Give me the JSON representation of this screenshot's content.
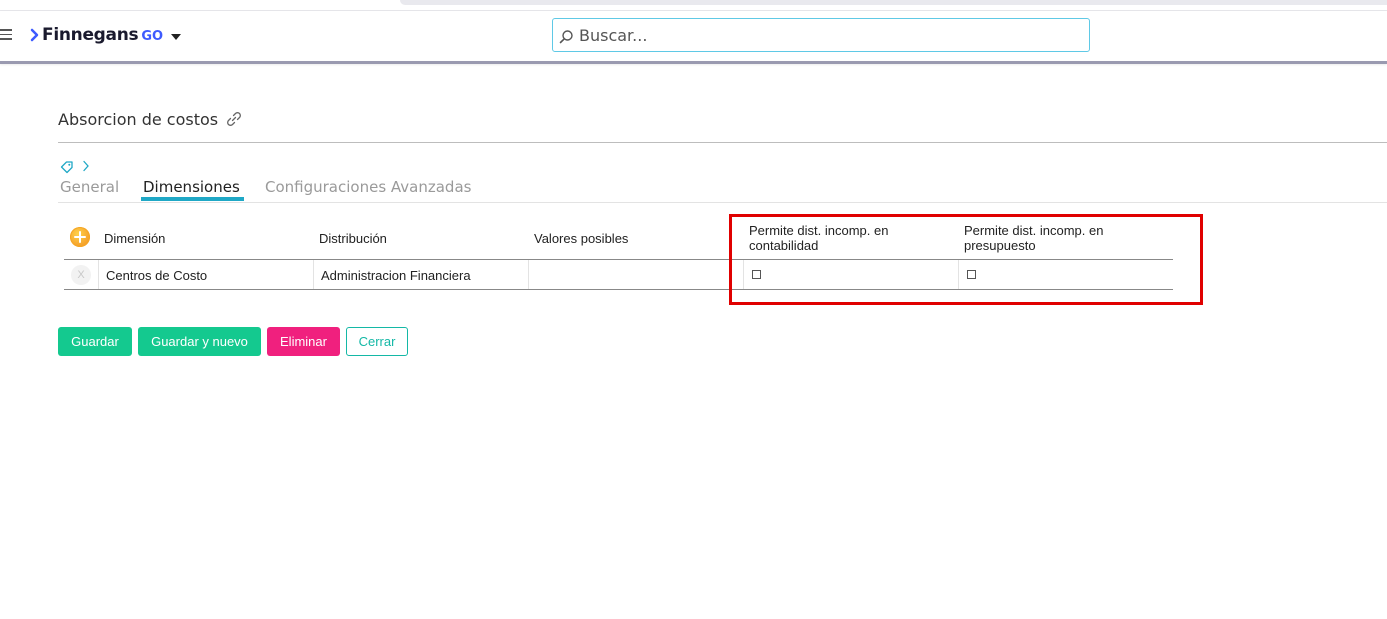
{
  "app": {
    "brand": "Finnegans",
    "brand_suffix": "GO"
  },
  "search": {
    "placeholder": "Buscar..."
  },
  "page": {
    "title": "Absorcion de costos"
  },
  "tabs": [
    {
      "label": "General",
      "active": false
    },
    {
      "label": "Dimensiones",
      "active": true
    },
    {
      "label": "Configuraciones Avanzadas",
      "active": false
    }
  ],
  "grid": {
    "headers": {
      "dimension": "Dimensión",
      "distribucion": "Distribución",
      "valores": "Valores posibles",
      "permite_contab": "Permite dist. incomp. en contabilidad",
      "permite_presup": "Permite dist. incomp. en presupuesto"
    },
    "rows": [
      {
        "delete_label": "X",
        "dimension": "Centros de Costo",
        "distribucion": "Administracion Financiera",
        "valores": "",
        "permite_contab": false,
        "permite_presup": false
      }
    ]
  },
  "actions": {
    "save": "Guardar",
    "save_new": "Guardar y nuevo",
    "delete": "Eliminar",
    "close": "Cerrar"
  },
  "colors": {
    "accent": "#1fa8c6",
    "success": "#14c98f",
    "danger": "#f0207e",
    "highlight": "#e00000"
  }
}
